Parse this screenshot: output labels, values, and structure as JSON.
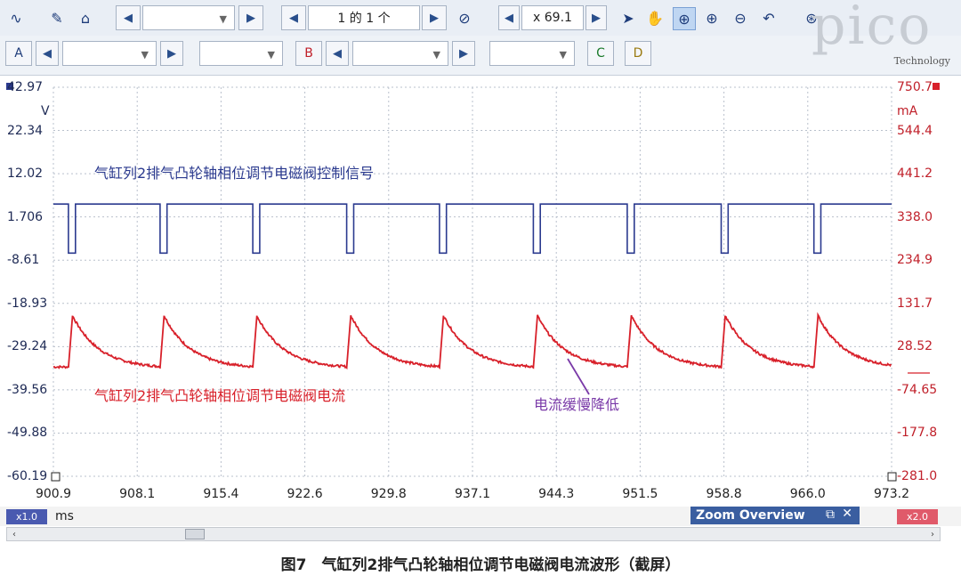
{
  "toolbar1": {
    "page_selector_value": "1 的 1 个",
    "zoom_value": "x 69.1",
    "icons": [
      "scope-icon",
      "wand-icon",
      "home-icon",
      "compass-icon",
      "pointer-icon",
      "hand-icon",
      "zoom-box-icon",
      "zoom-in-icon",
      "zoom-out-icon",
      "undo-icon",
      "zoom-fit-icon"
    ]
  },
  "toolbar2": {
    "channel_a": "A",
    "channel_b": "B",
    "channel_c": "C",
    "channel_d": "D"
  },
  "logo": {
    "text": "pico",
    "sub": "Technology"
  },
  "colors": {
    "blue": "#2b3a8f",
    "red": "#d8202a",
    "purple": "#7a3aa8",
    "grid": "#b9c0cc"
  },
  "axes": {
    "left_unit": "V",
    "right_unit": "mA",
    "x_unit": "ms",
    "left_ticks": [
      "42.97",
      "22.34",
      "12.02",
      "1.706",
      "-8.61",
      "-18.93",
      "-29.24",
      "-39.56",
      "-49.88",
      "-60.19"
    ],
    "right_ticks": [
      "750.7",
      "544.4",
      "441.2",
      "338.0",
      "234.9",
      "131.7",
      "28.52",
      "-74.65",
      "-177.8",
      "-281.0"
    ],
    "x_ticks": [
      "900.9",
      "908.1",
      "915.4",
      "922.6",
      "929.8",
      "937.1",
      "944.3",
      "951.5",
      "958.8",
      "966.0",
      "973.2"
    ]
  },
  "annotations": {
    "blue_label": "气缸列2排气凸轮轴相位调节电磁阀控制信号",
    "red_label": "气缸列2排气凸轮轴相位调节电磁阀电流",
    "arrow_label": "电流缓慢降低"
  },
  "status": {
    "left_scale": "x1.0",
    "right_scale": "x2.0",
    "zoom_overview": "Zoom Overview"
  },
  "caption": "图7　气缸列2排气凸轮轴相位调节电磁阀电流波形（截屏）",
  "chart_data": {
    "type": "line",
    "x_range": [
      900.9,
      973.2
    ],
    "xlabel": "ms",
    "series": [
      {
        "name": "气缸列2排气凸轮轴相位调节电磁阀控制信号",
        "unit": "V",
        "ylim": [
          -60.19,
          42.97
        ],
        "high": 12.0,
        "low": -1.0,
        "pulse_starts_ms": [
          902.2,
          910.1,
          918.1,
          926.2,
          934.2,
          942.3,
          950.4,
          958.5,
          966.5
        ],
        "pulse_width_ms": 0.6
      },
      {
        "name": "气缸列2排气凸轮轴相位调节电磁阀电流",
        "unit": "mA",
        "ylim": [
          -281.0,
          750.7
        ],
        "peak": 145,
        "valley": 5,
        "rise_starts_ms": [
          902.2,
          910.1,
          918.1,
          926.2,
          934.2,
          942.3,
          950.4,
          958.5,
          966.5
        ]
      }
    ]
  }
}
